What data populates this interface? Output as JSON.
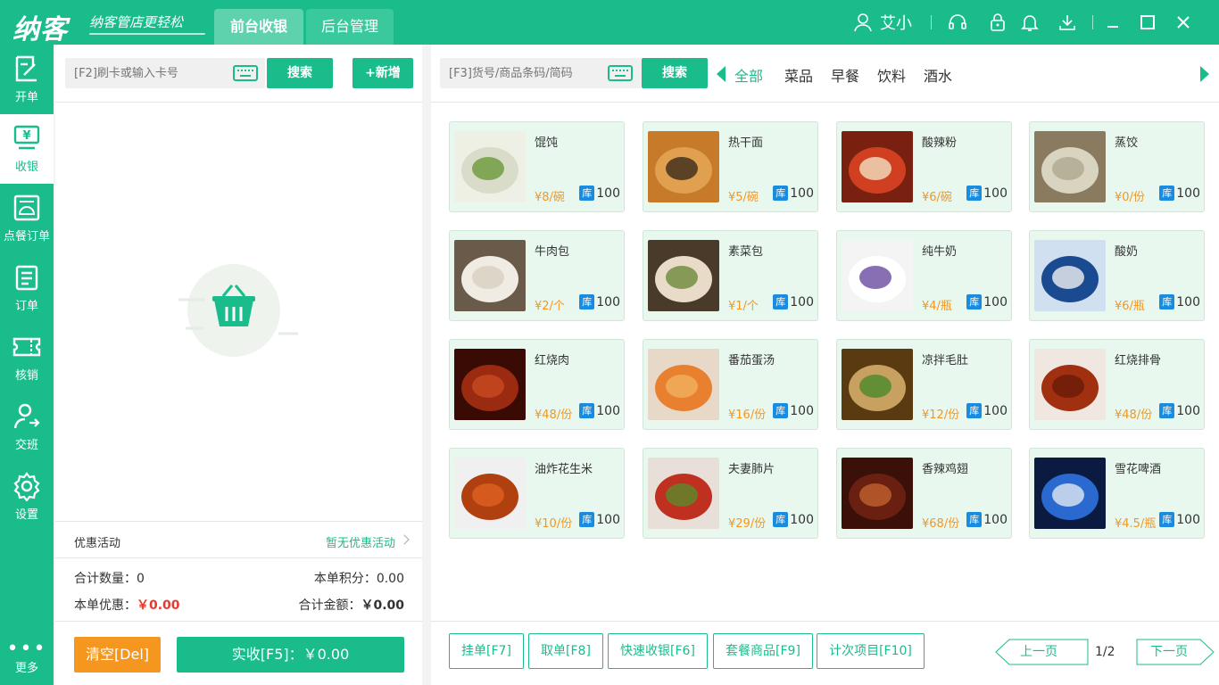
{
  "header": {
    "logo": "纳客",
    "slogan": "纳客管店更轻松",
    "tabs": [
      {
        "label": "前台收银",
        "active": true
      },
      {
        "label": "后台管理",
        "active": false
      }
    ],
    "user_name": "艾小",
    "icons": [
      "user-icon",
      "headset-icon",
      "lock-icon",
      "bell-icon",
      "download-icon"
    ],
    "window_controls": [
      "minimize-icon",
      "maximize-icon",
      "close-icon"
    ]
  },
  "sidebar": {
    "items": [
      {
        "label": "开单",
        "icon": "edit-icon",
        "active": false
      },
      {
        "label": "收银",
        "icon": "cashier-icon",
        "active": true
      },
      {
        "label": "点餐订单",
        "icon": "food-order-icon",
        "active": false
      },
      {
        "label": "订单",
        "icon": "order-list-icon",
        "active": false
      },
      {
        "label": "核销",
        "icon": "ticket-icon",
        "active": false
      },
      {
        "label": "交班",
        "icon": "shift-change-icon",
        "active": false
      },
      {
        "label": "设置",
        "icon": "gear-icon",
        "active": false
      }
    ],
    "more_label": "更多",
    "more_dots": "•••"
  },
  "left": {
    "card_placeholder": "[F2]刷卡或输入卡号",
    "search_label": "搜索",
    "add_label": "+新增",
    "promo_label": "优惠活动",
    "promo_value": "暂无优惠活动",
    "total_qty_label": "合计数量：",
    "total_qty_value": "0",
    "points_label": "本单积分：",
    "points_value": "0.00",
    "discount_label": "本单优惠：",
    "discount_value": "￥0.00",
    "total_amount_label": "合计金额：",
    "total_amount_value": "￥0.00",
    "clear_label": "清空[Del]",
    "pay_label": "实收[F5]：￥0.00"
  },
  "right": {
    "goods_placeholder": "[F3]货号/商品条码/简码",
    "search_label": "搜索",
    "categories": [
      {
        "label": "全部",
        "active": true
      },
      {
        "label": "菜品",
        "active": false
      },
      {
        "label": "早餐",
        "active": false
      },
      {
        "label": "饮料",
        "active": false
      },
      {
        "label": "酒水",
        "active": false
      }
    ],
    "stock_badge": "库",
    "products": [
      {
        "name": "馄饨",
        "price": "¥8/碗",
        "stock": "100"
      },
      {
        "name": "热干面",
        "price": "¥5/碗",
        "stock": "100"
      },
      {
        "name": "酸辣粉",
        "price": "¥6/碗",
        "stock": "100"
      },
      {
        "name": "蒸饺",
        "price": "¥0/份",
        "stock": "100"
      },
      {
        "name": "牛肉包",
        "price": "¥2/个",
        "stock": "100"
      },
      {
        "name": "素菜包",
        "price": "¥1/个",
        "stock": "100"
      },
      {
        "name": "纯牛奶",
        "price": "¥4/瓶",
        "stock": "100"
      },
      {
        "name": "酸奶",
        "price": "¥6/瓶",
        "stock": "100"
      },
      {
        "name": "红烧肉",
        "price": "¥48/份",
        "stock": "100"
      },
      {
        "name": "番茄蛋汤",
        "price": "¥16/份",
        "stock": "100"
      },
      {
        "name": "凉拌毛肚",
        "price": "¥12/份",
        "stock": "100"
      },
      {
        "name": "红烧排骨",
        "price": "¥48/份",
        "stock": "100"
      },
      {
        "name": "油炸花生米",
        "price": "¥10/份",
        "stock": "100"
      },
      {
        "name": "夫妻肺片",
        "price": "¥29/份",
        "stock": "100"
      },
      {
        "name": "香辣鸡翅",
        "price": "¥68/份",
        "stock": "100"
      },
      {
        "name": "雪花啤酒",
        "price": "¥4.5/瓶",
        "stock": "100"
      }
    ],
    "footer_buttons": [
      "挂单[F7]",
      "取单[F8]",
      "快速收银[F6]",
      "套餐商品[F9]",
      "计次项目[F10]"
    ],
    "prev_label": "上一页",
    "next_label": "下一页",
    "page_indicator": "1/2"
  },
  "colors": {
    "accent": "#1abc8c",
    "orange": "#f5961e",
    "price_red": "#e8382f",
    "stock_blue": "#1a8ce0"
  }
}
